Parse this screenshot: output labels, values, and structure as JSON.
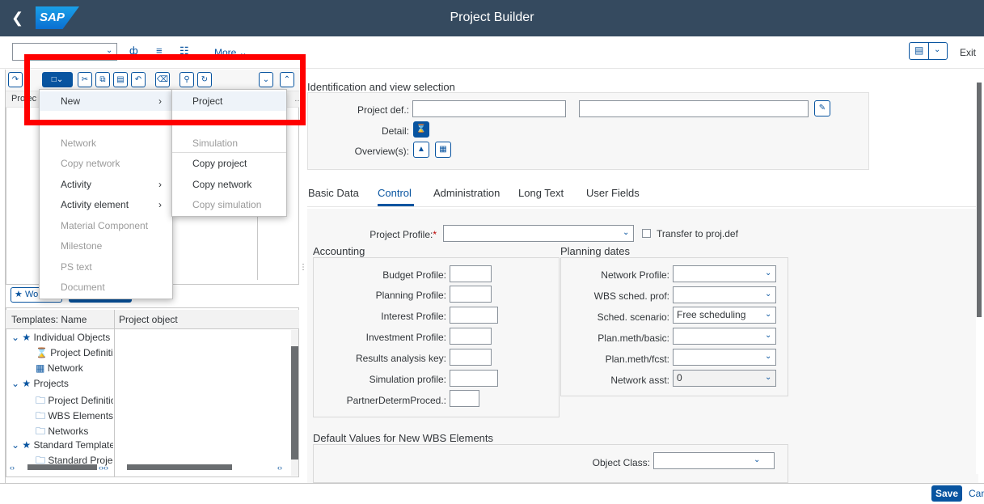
{
  "header": {
    "logo": "SAP",
    "title": "Project Builder"
  },
  "toolbar": {
    "more_label": "More",
    "exit_label": "Exit"
  },
  "left_panel": {
    "header_text": "Projec"
  },
  "worklist": {
    "label": "Wo"
  },
  "context_menu": {
    "items": [
      {
        "label": "New",
        "enabled": true,
        "has_sub": true
      },
      {
        "label": "",
        "enabled": false,
        "has_sub": false
      },
      {
        "label": "Network",
        "enabled": false,
        "has_sub": false
      },
      {
        "label": "Copy network",
        "enabled": false,
        "has_sub": false
      },
      {
        "label": "Activity",
        "enabled": true,
        "has_sub": true
      },
      {
        "label": "Activity element",
        "enabled": true,
        "has_sub": true
      },
      {
        "label": "Material Component",
        "enabled": false,
        "has_sub": false
      },
      {
        "label": "Milestone",
        "enabled": false,
        "has_sub": false
      },
      {
        "label": "PS text",
        "enabled": false,
        "has_sub": false
      },
      {
        "label": "Document",
        "enabled": false,
        "has_sub": false
      }
    ],
    "submenu": [
      {
        "label": "Project",
        "enabled": true
      },
      {
        "label": "",
        "enabled": false
      },
      {
        "label": "Simulation",
        "enabled": false
      },
      {
        "label": "Copy project",
        "enabled": true
      },
      {
        "label": "Copy network",
        "enabled": true
      },
      {
        "label": "Copy simulation",
        "enabled": false
      }
    ]
  },
  "templates": {
    "col_name": "Templates: Name",
    "col_object": "Project object",
    "rows": [
      {
        "label": "Individual Objects",
        "level": 0
      },
      {
        "label": "Project Definition",
        "level": 1
      },
      {
        "label": "Network",
        "level": 1
      },
      {
        "label": "Projects",
        "level": 0
      },
      {
        "label": "Project Definition",
        "level": 1
      },
      {
        "label": "WBS Elements",
        "level": 1
      },
      {
        "label": "Networks",
        "level": 1
      },
      {
        "label": "Standard Templates",
        "level": 0
      },
      {
        "label": "Standard Project",
        "level": 1
      }
    ]
  },
  "identification": {
    "section_title": "Identification and view selection",
    "project_def_label": "Project def.:",
    "detail_label": "Detail:",
    "overview_label": "Overview(s):"
  },
  "tabs": [
    "Basic Data",
    "Control",
    "Administration",
    "Long Text",
    "User Fields"
  ],
  "control": {
    "project_profile_label": "Project Profile:",
    "required_mark": "*",
    "transfer_label": "Transfer to proj.def",
    "accounting": {
      "title": "Accounting",
      "fields": [
        "Budget Profile:",
        "Planning Profile:",
        "Interest Profile:",
        "Investment Profile:",
        "Results analysis key:",
        "Simulation profile:",
        "PartnerDetermProced.:"
      ]
    },
    "planning": {
      "title": "Planning dates",
      "fields": [
        {
          "label": "Network Profile:",
          "value": ""
        },
        {
          "label": "WBS sched. prof:",
          "value": ""
        },
        {
          "label": "Sched. scenario:",
          "value": "Free scheduling"
        },
        {
          "label": "Plan.meth/basic:",
          "value": ""
        },
        {
          "label": "Plan.meth/fcst:",
          "value": ""
        },
        {
          "label": "Network asst:",
          "value": "0"
        }
      ]
    },
    "defaults": {
      "title": "Default Values for New WBS Elements",
      "object_class_label": "Object Class:"
    }
  },
  "footer": {
    "save_label": "Save",
    "cancel_label": "Cancel"
  },
  "colors": {
    "accent": "#0854a0",
    "shell": "#354a5f",
    "highlight": "#ff0000"
  }
}
